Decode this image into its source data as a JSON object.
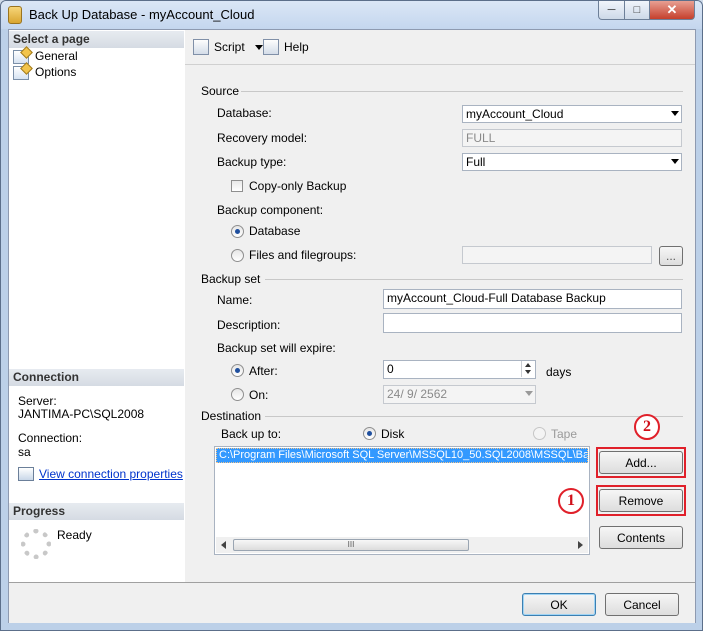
{
  "window": {
    "title": "Back Up Database - myAccount_Cloud",
    "controls": {
      "minimize": "─",
      "maximize": "□",
      "close": "✕"
    }
  },
  "left_pane": {
    "select_page_header": "Select a page",
    "pages": [
      {
        "label": "General",
        "icon": "page-icon"
      },
      {
        "label": "Options",
        "icon": "page-icon"
      }
    ],
    "connection_header": "Connection",
    "server_label": "Server:",
    "server_value": "JANTIMA-PC\\SQL2008",
    "connection_label": "Connection:",
    "connection_value": "sa",
    "view_connection_link": "View connection properties",
    "progress_header": "Progress",
    "progress_status": "Ready"
  },
  "toolbar": {
    "script_label": "Script",
    "help_label": "Help"
  },
  "source": {
    "header": "Source",
    "database_label": "Database:",
    "database_value": "myAccount_Cloud",
    "recovery_model_label": "Recovery model:",
    "recovery_model_value": "FULL",
    "backup_type_label": "Backup type:",
    "backup_type_value": "Full",
    "copy_only_label": "Copy-only Backup",
    "copy_only_checked": false,
    "backup_component_label": "Backup component:",
    "component_database_label": "Database",
    "component_files_label": "Files and filegroups:",
    "component_selected": "Database",
    "files_browse_label": "..."
  },
  "backup_set": {
    "header": "Backup set",
    "name_label": "Name:",
    "name_value": "myAccount_Cloud-Full Database Backup",
    "description_label": "Description:",
    "description_value": "",
    "expire_label": "Backup set will expire:",
    "after_label": "After:",
    "after_value": "0",
    "days_label": "days",
    "on_label": "On:",
    "on_value": "24/ 9/ 2562",
    "expire_selected": "After"
  },
  "destination": {
    "header": "Destination",
    "back_up_to_label": "Back up to:",
    "disk_label": "Disk",
    "tape_label": "Tape",
    "selected": "Disk",
    "paths": [
      "C:\\Program Files\\Microsoft SQL Server\\MSSQL10_50.SQL2008\\MSSQL\\Backup"
    ],
    "add_label": "Add...",
    "remove_label": "Remove",
    "contents_label": "Contents",
    "scroll_thumb_label": "III"
  },
  "annotations": {
    "callout_1": "1",
    "callout_2": "2",
    "highlight_color": "#e0202a"
  },
  "footer": {
    "ok_label": "OK",
    "cancel_label": "Cancel"
  },
  "colors": {
    "selection": "#3399ff",
    "link": "#0033cc",
    "title_bar": "#c4d6ee"
  }
}
